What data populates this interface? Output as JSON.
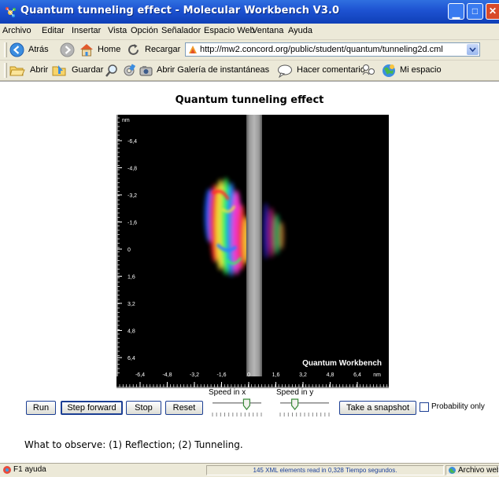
{
  "window": {
    "title": "Quantum tunneling effect - Molecular Workbench V3.0"
  },
  "menu": [
    "Archivo",
    "Editar",
    "Insertar",
    "Vista",
    "Opción",
    "Señalador",
    "Espacio Web",
    "Ventana",
    "Ayuda"
  ],
  "nav": {
    "back_label": "Atrás",
    "home_label": "Home",
    "reload_label": "Recargar",
    "address_url": "http://mw2.concord.org/public/student/quantum/tunneling2d.cml"
  },
  "toolbar": {
    "open_label": "Abrir",
    "save_label": "Guardar",
    "gallery_label": "Abrir Galería de instantáneas",
    "comment_label": "Hacer comentario",
    "myspace_label": "Mi espacio"
  },
  "page": {
    "title": "Quantum tunneling effect",
    "observe_text": "What to observe: (1) Reflection; (2) Tunneling."
  },
  "simulation": {
    "y_unit": "nm",
    "x_unit": "nm",
    "y_ticks": [
      "-6,4",
      "-4,8",
      "-3,2",
      "-1,6",
      "0",
      "1,6",
      "3,2",
      "4,8",
      "6,4"
    ],
    "x_ticks": [
      "-6,4",
      "-4,8",
      "-3,2",
      "-1,6",
      "0",
      "1,6",
      "3,2",
      "4,8",
      "6,4"
    ],
    "watermark": "Quantum Workbench"
  },
  "controls": {
    "run_label": "Run",
    "step_label": "Step forward",
    "stop_label": "Stop",
    "reset_label": "Reset",
    "speed_x_label": "Speed in x",
    "speed_y_label": "Speed in y",
    "speed_x_value": 0.7,
    "speed_y_value": 0.3,
    "snapshot_label": "Take a snapshot",
    "probability_label": "Probability only",
    "probability_checked": false
  },
  "status": {
    "help": "F1 ayuda",
    "message": "145 XML elements read in 0,328 Tiempo segundos.",
    "right": "Archivo web"
  },
  "colors": {
    "title_bar": "#1d52d1",
    "chrome": "#ece9d8",
    "barrier": "#8a8a8a"
  }
}
